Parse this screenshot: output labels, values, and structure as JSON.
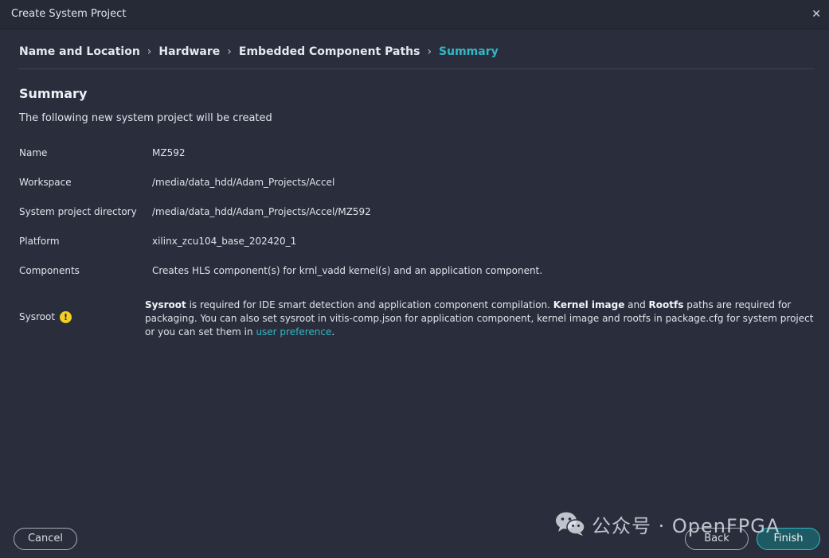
{
  "window": {
    "title": "Create System Project"
  },
  "breadcrumb": [
    {
      "label": "Name and Location"
    },
    {
      "label": "Hardware"
    },
    {
      "label": "Embedded Component Paths"
    },
    {
      "label": "Summary"
    }
  ],
  "summary": {
    "heading": "Summary",
    "subtitle": "The following new system project will be created",
    "rows": [
      {
        "label": "Name",
        "value": "MZ592"
      },
      {
        "label": "Workspace",
        "value": "/media/data_hdd/Adam_Projects/Accel"
      },
      {
        "label": "System project directory",
        "value": "/media/data_hdd/Adam_Projects/Accel/MZ592"
      },
      {
        "label": "Platform",
        "value": "xilinx_zcu104_base_202420_1"
      },
      {
        "label": "Components",
        "value": "Creates HLS component(s) for krnl_vadd kernel(s) and an application component."
      }
    ],
    "sysroot": {
      "label": "Sysroot",
      "warning_icon": "warning-icon",
      "b1": "Sysroot",
      "t1": " is required for IDE smart detection and application component compilation. ",
      "b2": "Kernel image",
      "t2": " and ",
      "b3": "Rootfs",
      "t3": " paths are required for packaging. You can also set sysroot in vitis-comp.json for application component, kernel image and rootfs in package.cfg for system project or you can set them in ",
      "link": "user preference",
      "t4": "."
    }
  },
  "buttons": {
    "cancel": "Cancel",
    "back": "Back",
    "finish": "Finish"
  },
  "watermark": {
    "text": "公众号 · OpenFPGA",
    "icon": "wechat-icon"
  },
  "colors": {
    "accent": "#33b6c4",
    "background": "#2a2e3c",
    "warning": "#f2cf22"
  }
}
